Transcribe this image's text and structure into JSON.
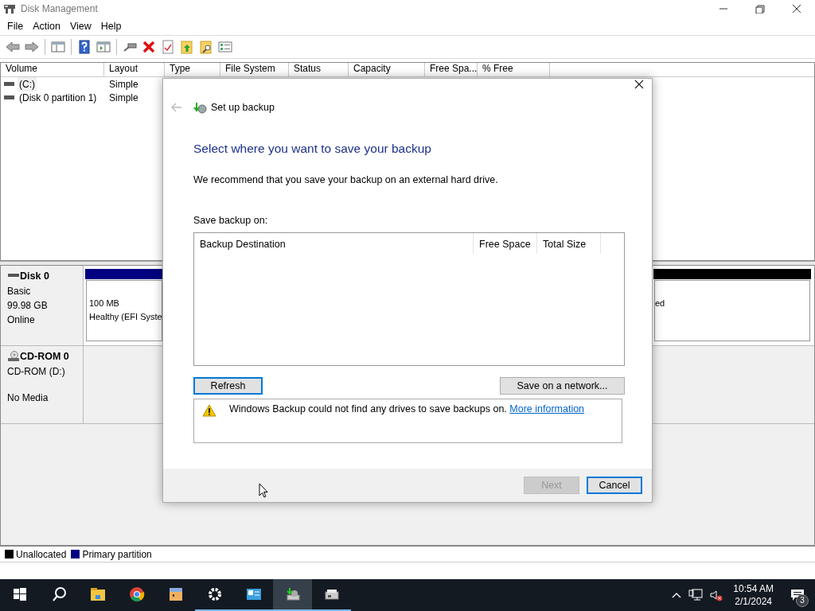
{
  "window": {
    "title": "Disk Management",
    "menu": [
      "File",
      "Action",
      "View",
      "Help"
    ]
  },
  "volume_list": {
    "columns": [
      "Volume",
      "Layout",
      "Type",
      "File System",
      "Status",
      "Capacity",
      "Free Spa...",
      "% Free"
    ],
    "rows": [
      {
        "volume": "(C:)",
        "layout": "Simple",
        "selected": true
      },
      {
        "volume": "(Disk 0 partition 1)",
        "layout": "Simple",
        "selected": false
      }
    ]
  },
  "disks": [
    {
      "kind": "disk",
      "name": "Disk 0",
      "details": [
        "Basic",
        "99.98 GB",
        "Online"
      ],
      "partitions": [
        {
          "color": "#000080",
          "lines": [
            "100 MB",
            "Healthy (EFI Syste"
          ]
        },
        {
          "color": "#000000",
          "lines": [
            "ed"
          ]
        }
      ]
    },
    {
      "kind": "cdrom",
      "name": "CD-ROM 0",
      "details": [
        "CD-ROM (D:)"
      ],
      "status": "No Media"
    }
  ],
  "legend": [
    {
      "label": "Unallocated",
      "color": "#000000"
    },
    {
      "label": "Primary partition",
      "color": "#000080"
    }
  ],
  "dialog": {
    "title": "Set up backup",
    "heading": "Select where you want to save your backup",
    "intro": "We recommend that you save your backup on an external hard drive.",
    "list_label": "Save backup on:",
    "columns": [
      "Backup Destination",
      "Free Space",
      "Total Size"
    ],
    "refresh": {
      "label": "Refresh",
      "focused": true
    },
    "network": {
      "label": "Save on a network...",
      "focused": false
    },
    "message": {
      "text": "Windows Backup could not find any drives to save backups on.",
      "link": "More information"
    },
    "buttons": [
      {
        "label": "Next",
        "disabled": true,
        "focused": false
      },
      {
        "label": "Cancel",
        "disabled": false,
        "focused": true
      }
    ]
  },
  "taskbar": {
    "apps": [
      {
        "kind": "start",
        "running": false,
        "selected": false
      },
      {
        "kind": "search",
        "running": false,
        "selected": false
      },
      {
        "kind": "folder",
        "running": false,
        "selected": false
      },
      {
        "kind": "browser",
        "running": false,
        "selected": false
      },
      {
        "kind": "cube",
        "running": false,
        "selected": false
      },
      {
        "kind": "gear",
        "running": true,
        "selected": false
      },
      {
        "kind": "panel",
        "running": true,
        "selected": false
      },
      {
        "kind": "backup",
        "running": true,
        "selected": true
      },
      {
        "kind": "drive",
        "running": true,
        "selected": false
      }
    ],
    "time": "10:54 AM",
    "date": "2/1/2024",
    "notifications": "3"
  }
}
